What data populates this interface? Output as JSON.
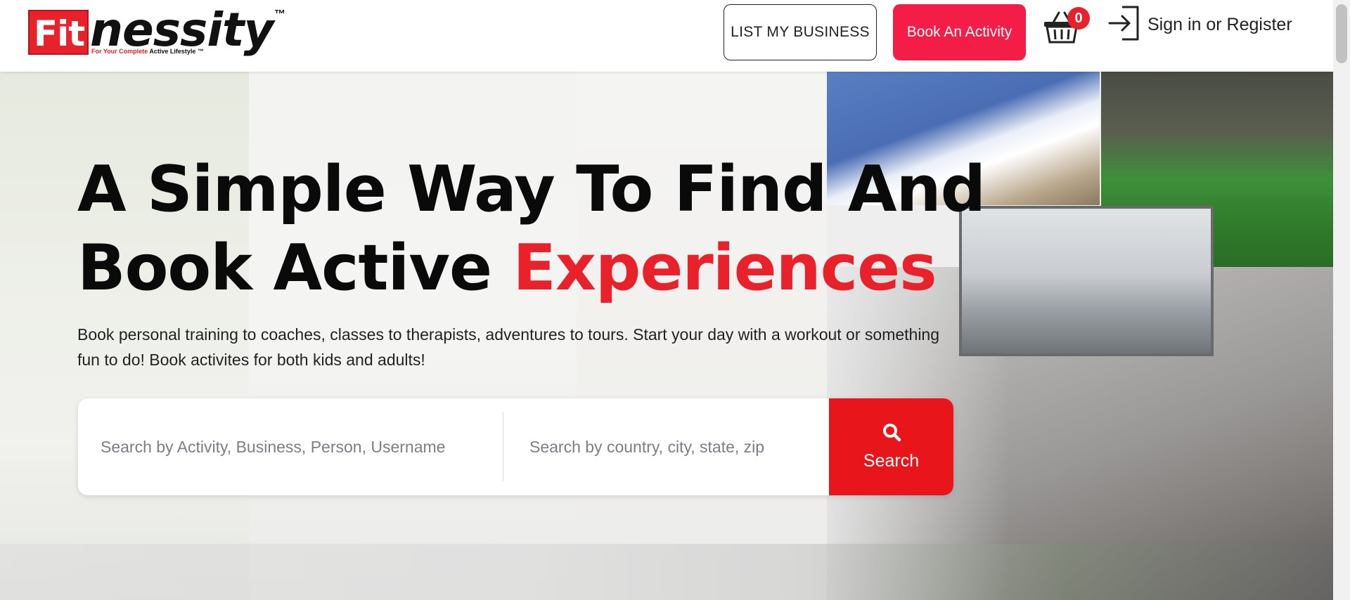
{
  "header": {
    "logo": {
      "brand_fit": "Fit",
      "brand_rest": "nessity",
      "trademark": "™",
      "tagline_red": "For Your Complete",
      "tagline_dark": "Active Lifestyle ™"
    },
    "list_business_label": "LIST MY BUSINESS",
    "book_activity_label": "Book An Activity",
    "cart_count": "0",
    "signin_label": "Sign in or Register"
  },
  "hero": {
    "headline_line1": "A Simple Way To Find And",
    "headline_line2_black": "Book Active ",
    "headline_line2_red": "Experiences",
    "subtext": "Book personal training to coaches, classes to therapists, adventures to tours. Start your day with a workout or something fun to do! Book activites for both kids and adults!"
  },
  "search": {
    "activity_placeholder": "Search by Activity, Business, Person, Username",
    "activity_value": "",
    "location_placeholder": "Search by country, city, state, zip",
    "location_value": "",
    "button_label": "Search"
  },
  "colors": {
    "brand_red": "#e8212a",
    "book_button": "#f41d47",
    "search_button": "#e8151b"
  },
  "icons": {
    "cart": "shopping-basket-icon",
    "signin": "sign-in-icon",
    "search": "magnifier-icon"
  }
}
